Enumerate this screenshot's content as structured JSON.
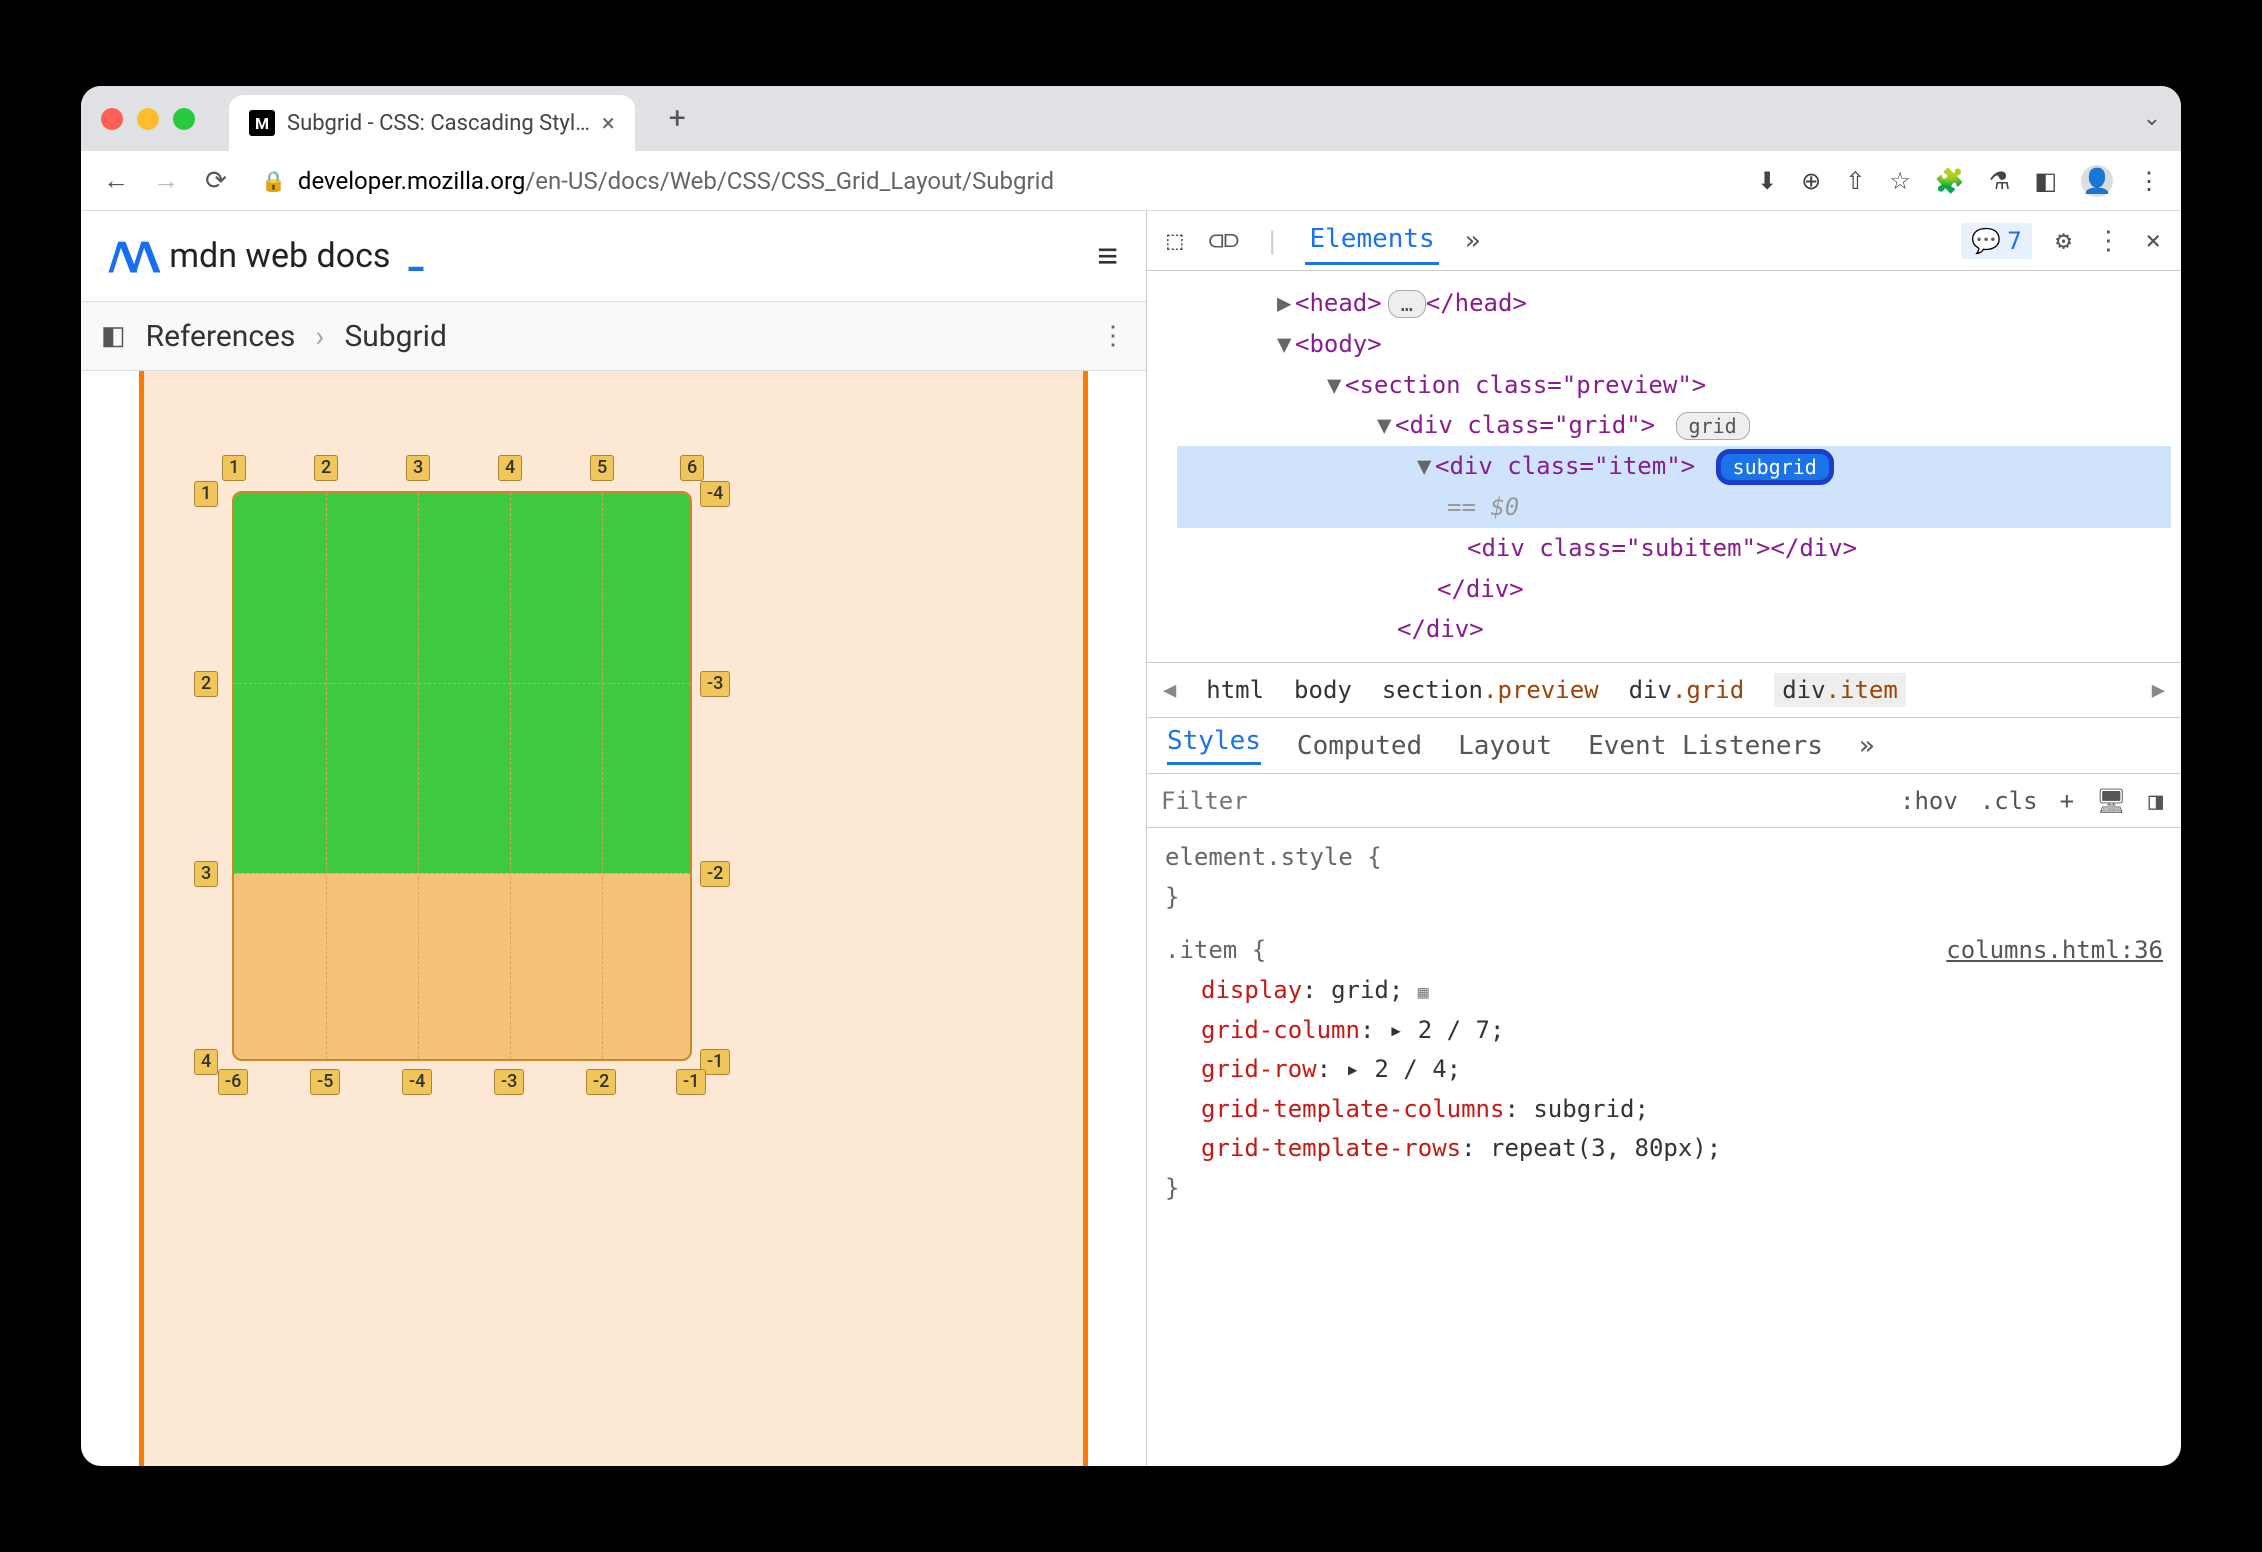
{
  "tab": {
    "title": "Subgrid - CSS: Cascading Styl…"
  },
  "url": {
    "domain": "developer.mozilla.org",
    "path": "/en-US/docs/Web/CSS/CSS_Grid_Layout/Subgrid"
  },
  "mdn": {
    "logo_text": "mdn web docs"
  },
  "breadcrumb": {
    "item1": "References",
    "item2": "Subgrid"
  },
  "devtools": {
    "panel": "Elements",
    "issues_count": "7",
    "dom": {
      "head_open": "<head>",
      "head_dots": "…",
      "head_close": "</head>",
      "body": "<body>",
      "section": "<section class=\"preview\">",
      "div_grid": "<div class=\"grid\">",
      "badge_grid": "grid",
      "div_item": "<div class=\"item\">",
      "badge_subgrid": "subgrid",
      "eq0": "== $0",
      "subitem": "<div class=\"subitem\"></div>",
      "close_div1": "</div>",
      "close_div2": "</div>"
    },
    "crumbs": {
      "c1": "html",
      "c2": "body",
      "c3": "section",
      "c3c": ".preview",
      "c4": "div",
      "c4c": ".grid",
      "c5": "div",
      "c5c": ".item"
    },
    "styles_tabs": {
      "t1": "Styles",
      "t2": "Computed",
      "t3": "Layout",
      "t4": "Event Listeners"
    },
    "filter": {
      "placeholder": "Filter",
      "hov": ":hov",
      "cls": ".cls"
    },
    "css": {
      "elstyle": "element.style {",
      "close": "}",
      "item_sel": ".item {",
      "src": "columns.html:36",
      "p1": "display",
      "v1": "grid",
      "p2": "grid-column",
      "v2": "2 / 7",
      "p3": "grid-row",
      "v3": "2 / 4",
      "p4": "grid-template-columns",
      "v4": "subgrid",
      "p5": "grid-template-rows",
      "v5": "repeat(3, 80px)"
    }
  },
  "grid_labels": {
    "top": [
      "1",
      "2",
      "3",
      "4",
      "5",
      "6"
    ],
    "left": [
      "1",
      "2",
      "3",
      "4"
    ],
    "right": [
      "-4",
      "-3",
      "-2",
      "-1"
    ],
    "bottom": [
      "-6",
      "-5",
      "-4",
      "-3",
      "-2",
      "-1"
    ]
  }
}
